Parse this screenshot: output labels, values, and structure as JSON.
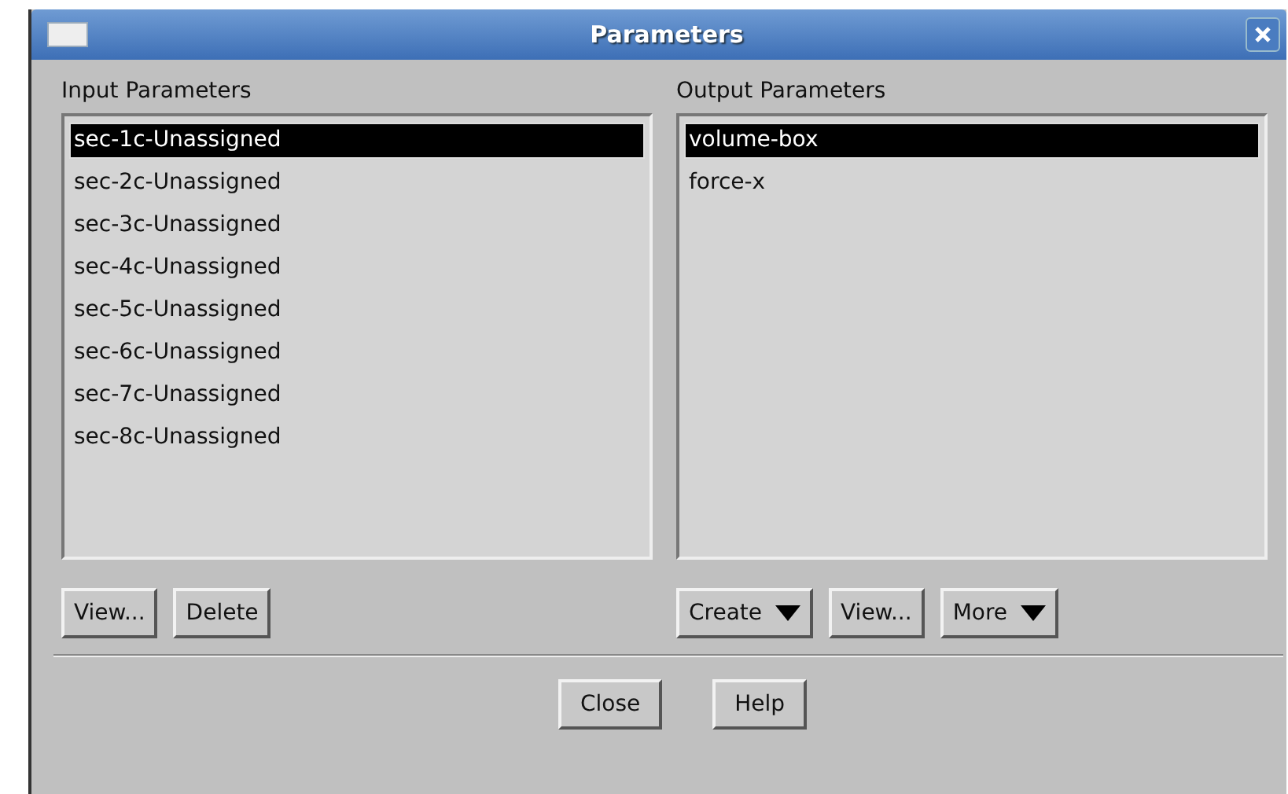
{
  "window": {
    "title": "Parameters"
  },
  "panels": [
    {
      "heading": "Input Parameters",
      "items": [
        {
          "label": "sec-1c-Unassigned",
          "selected": true
        },
        {
          "label": "sec-2c-Unassigned",
          "selected": false
        },
        {
          "label": "sec-3c-Unassigned",
          "selected": false
        },
        {
          "label": "sec-4c-Unassigned",
          "selected": false
        },
        {
          "label": "sec-5c-Unassigned",
          "selected": false
        },
        {
          "label": "sec-6c-Unassigned",
          "selected": false
        },
        {
          "label": "sec-7c-Unassigned",
          "selected": false
        },
        {
          "label": "sec-8c-Unassigned",
          "selected": false
        }
      ],
      "buttons": [
        {
          "label": "View...",
          "kind": "push"
        },
        {
          "label": "Delete",
          "kind": "push"
        }
      ]
    },
    {
      "heading": "Output Parameters",
      "items": [
        {
          "label": "volume-box",
          "selected": true
        },
        {
          "label": "force-x",
          "selected": false
        }
      ],
      "buttons": [
        {
          "label": "Create",
          "kind": "menu"
        },
        {
          "label": "View...",
          "kind": "push"
        },
        {
          "label": "More",
          "kind": "menu"
        }
      ]
    }
  ],
  "footer_buttons": [
    "Close",
    "Help"
  ]
}
